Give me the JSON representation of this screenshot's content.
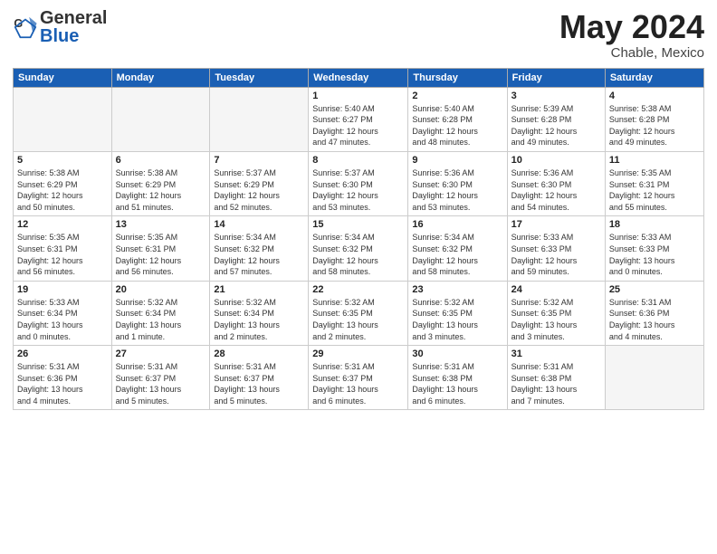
{
  "header": {
    "logo_general": "General",
    "logo_blue": "Blue",
    "month_year": "May 2024",
    "location": "Chable, Mexico"
  },
  "weekdays": [
    "Sunday",
    "Monday",
    "Tuesday",
    "Wednesday",
    "Thursday",
    "Friday",
    "Saturday"
  ],
  "weeks": [
    [
      {
        "day": "",
        "info": "",
        "shade": true
      },
      {
        "day": "",
        "info": "",
        "shade": true
      },
      {
        "day": "",
        "info": "",
        "shade": true
      },
      {
        "day": "1",
        "info": "Sunrise: 5:40 AM\nSunset: 6:27 PM\nDaylight: 12 hours\nand 47 minutes."
      },
      {
        "day": "2",
        "info": "Sunrise: 5:40 AM\nSunset: 6:28 PM\nDaylight: 12 hours\nand 48 minutes."
      },
      {
        "day": "3",
        "info": "Sunrise: 5:39 AM\nSunset: 6:28 PM\nDaylight: 12 hours\nand 49 minutes."
      },
      {
        "day": "4",
        "info": "Sunrise: 5:38 AM\nSunset: 6:28 PM\nDaylight: 12 hours\nand 49 minutes."
      }
    ],
    [
      {
        "day": "5",
        "info": "Sunrise: 5:38 AM\nSunset: 6:29 PM\nDaylight: 12 hours\nand 50 minutes."
      },
      {
        "day": "6",
        "info": "Sunrise: 5:38 AM\nSunset: 6:29 PM\nDaylight: 12 hours\nand 51 minutes."
      },
      {
        "day": "7",
        "info": "Sunrise: 5:37 AM\nSunset: 6:29 PM\nDaylight: 12 hours\nand 52 minutes."
      },
      {
        "day": "8",
        "info": "Sunrise: 5:37 AM\nSunset: 6:30 PM\nDaylight: 12 hours\nand 53 minutes."
      },
      {
        "day": "9",
        "info": "Sunrise: 5:36 AM\nSunset: 6:30 PM\nDaylight: 12 hours\nand 53 minutes."
      },
      {
        "day": "10",
        "info": "Sunrise: 5:36 AM\nSunset: 6:30 PM\nDaylight: 12 hours\nand 54 minutes."
      },
      {
        "day": "11",
        "info": "Sunrise: 5:35 AM\nSunset: 6:31 PM\nDaylight: 12 hours\nand 55 minutes."
      }
    ],
    [
      {
        "day": "12",
        "info": "Sunrise: 5:35 AM\nSunset: 6:31 PM\nDaylight: 12 hours\nand 56 minutes."
      },
      {
        "day": "13",
        "info": "Sunrise: 5:35 AM\nSunset: 6:31 PM\nDaylight: 12 hours\nand 56 minutes."
      },
      {
        "day": "14",
        "info": "Sunrise: 5:34 AM\nSunset: 6:32 PM\nDaylight: 12 hours\nand 57 minutes."
      },
      {
        "day": "15",
        "info": "Sunrise: 5:34 AM\nSunset: 6:32 PM\nDaylight: 12 hours\nand 58 minutes."
      },
      {
        "day": "16",
        "info": "Sunrise: 5:34 AM\nSunset: 6:32 PM\nDaylight: 12 hours\nand 58 minutes."
      },
      {
        "day": "17",
        "info": "Sunrise: 5:33 AM\nSunset: 6:33 PM\nDaylight: 12 hours\nand 59 minutes."
      },
      {
        "day": "18",
        "info": "Sunrise: 5:33 AM\nSunset: 6:33 PM\nDaylight: 13 hours\nand 0 minutes."
      }
    ],
    [
      {
        "day": "19",
        "info": "Sunrise: 5:33 AM\nSunset: 6:34 PM\nDaylight: 13 hours\nand 0 minutes."
      },
      {
        "day": "20",
        "info": "Sunrise: 5:32 AM\nSunset: 6:34 PM\nDaylight: 13 hours\nand 1 minute."
      },
      {
        "day": "21",
        "info": "Sunrise: 5:32 AM\nSunset: 6:34 PM\nDaylight: 13 hours\nand 2 minutes."
      },
      {
        "day": "22",
        "info": "Sunrise: 5:32 AM\nSunset: 6:35 PM\nDaylight: 13 hours\nand 2 minutes."
      },
      {
        "day": "23",
        "info": "Sunrise: 5:32 AM\nSunset: 6:35 PM\nDaylight: 13 hours\nand 3 minutes."
      },
      {
        "day": "24",
        "info": "Sunrise: 5:32 AM\nSunset: 6:35 PM\nDaylight: 13 hours\nand 3 minutes."
      },
      {
        "day": "25",
        "info": "Sunrise: 5:31 AM\nSunset: 6:36 PM\nDaylight: 13 hours\nand 4 minutes."
      }
    ],
    [
      {
        "day": "26",
        "info": "Sunrise: 5:31 AM\nSunset: 6:36 PM\nDaylight: 13 hours\nand 4 minutes."
      },
      {
        "day": "27",
        "info": "Sunrise: 5:31 AM\nSunset: 6:37 PM\nDaylight: 13 hours\nand 5 minutes."
      },
      {
        "day": "28",
        "info": "Sunrise: 5:31 AM\nSunset: 6:37 PM\nDaylight: 13 hours\nand 5 minutes."
      },
      {
        "day": "29",
        "info": "Sunrise: 5:31 AM\nSunset: 6:37 PM\nDaylight: 13 hours\nand 6 minutes."
      },
      {
        "day": "30",
        "info": "Sunrise: 5:31 AM\nSunset: 6:38 PM\nDaylight: 13 hours\nand 6 minutes."
      },
      {
        "day": "31",
        "info": "Sunrise: 5:31 AM\nSunset: 6:38 PM\nDaylight: 13 hours\nand 7 minutes."
      },
      {
        "day": "",
        "info": "",
        "shade": true
      }
    ]
  ]
}
